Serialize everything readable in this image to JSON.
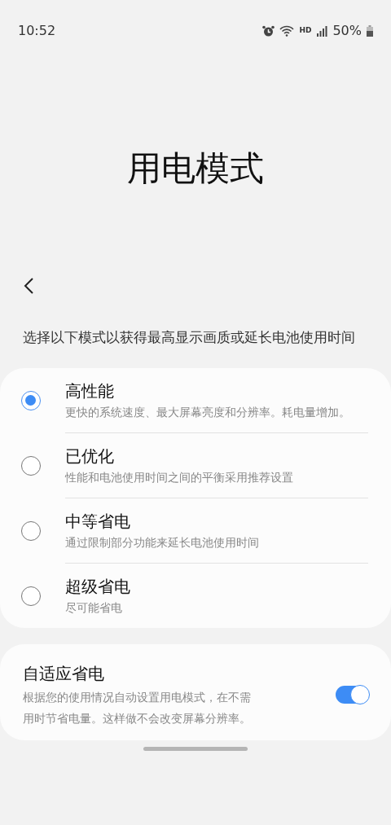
{
  "status_bar": {
    "time": "10:52",
    "network": "HD",
    "battery": "50%"
  },
  "title": "用电模式",
  "description": "选择以下模式以获得最高显示画质或延长电池使用时间",
  "modes": [
    {
      "title": "高性能",
      "subtitle": "更快的系统速度、最大屏幕亮度和分辨率。耗电量增加。",
      "selected": true
    },
    {
      "title": "已优化",
      "subtitle": "性能和电池使用时间之间的平衡采用推荐设置",
      "selected": false
    },
    {
      "title": "中等省电",
      "subtitle": "通过限制部分功能来延长电池使用时间",
      "selected": false
    },
    {
      "title": "超级省电",
      "subtitle": "尽可能省电",
      "selected": false
    }
  ],
  "adaptive": {
    "title": "自适应省电",
    "description_lines": [
      "根据您的使用情况自动设置用电模式，在不需",
      "用时节省电量。这样做不会改变屏幕分辨率。"
    ],
    "on": true
  }
}
